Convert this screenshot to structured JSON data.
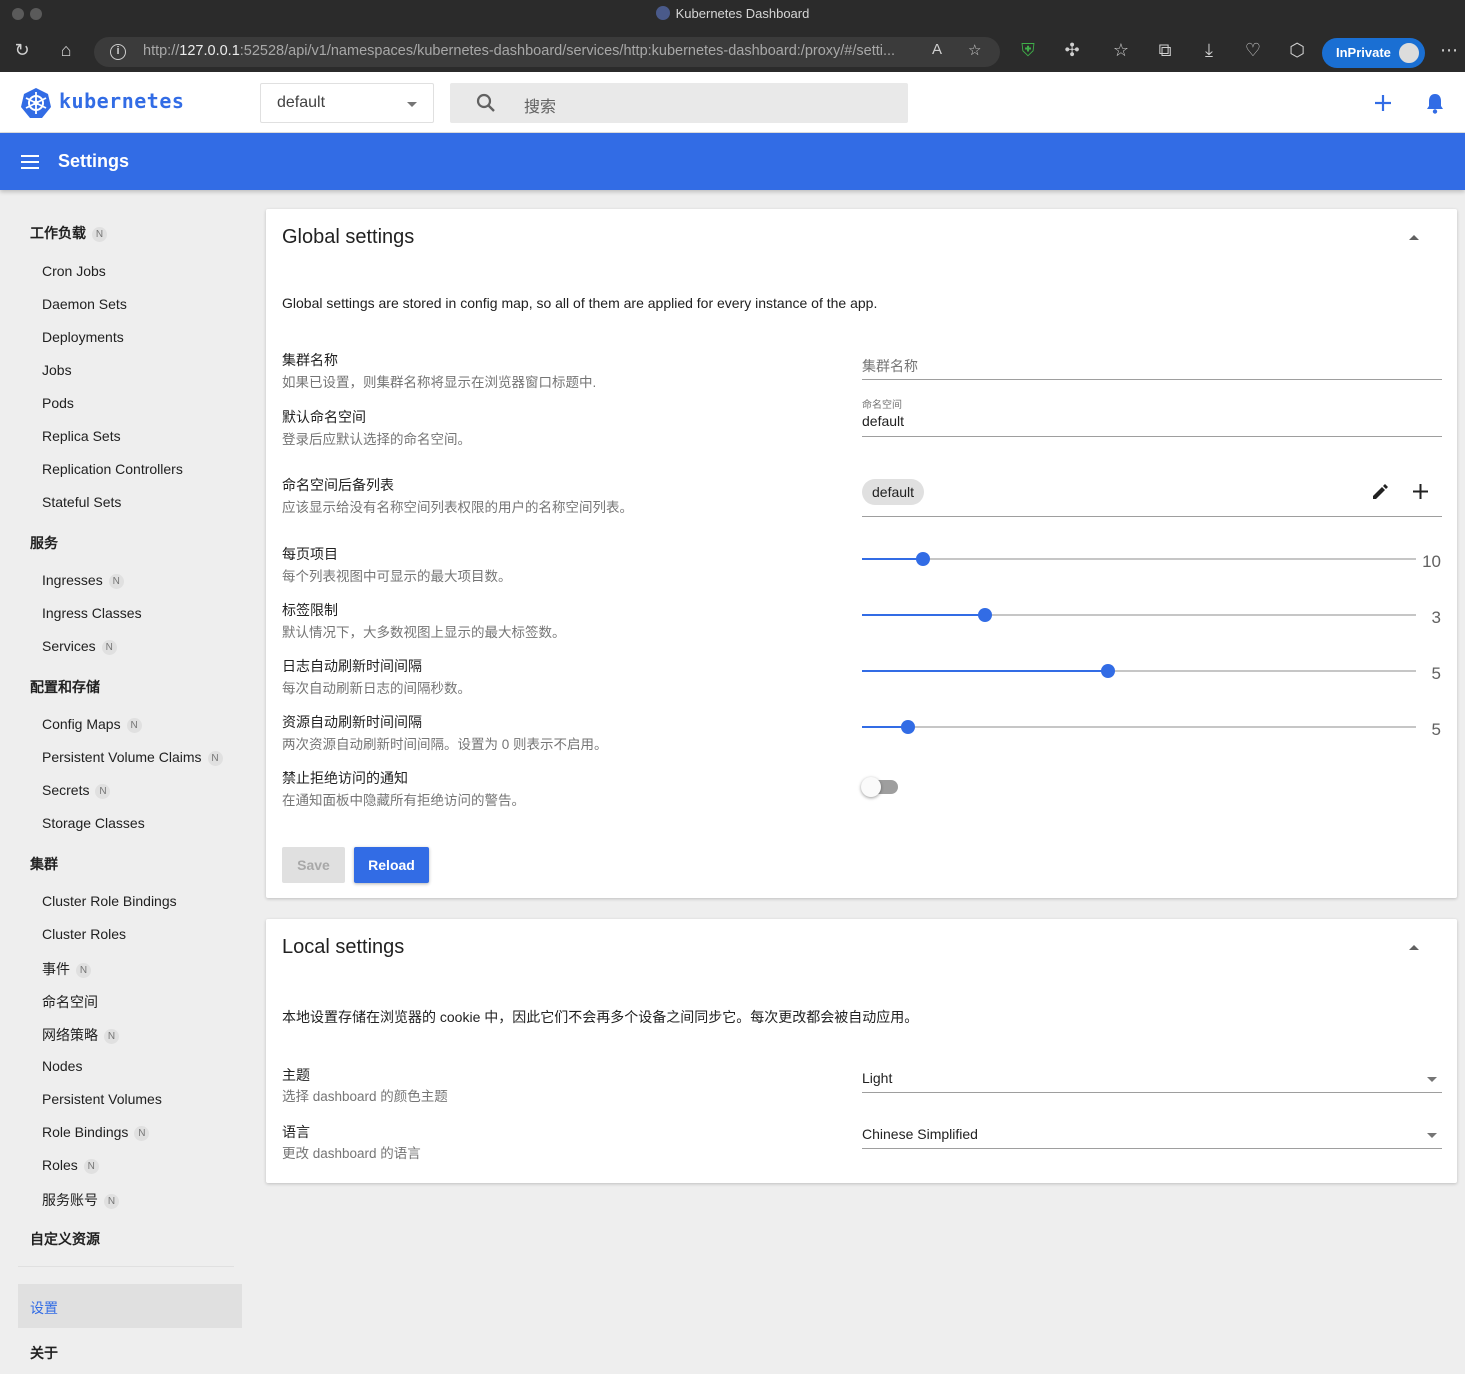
{
  "browser": {
    "window_title": "Kubernetes Dashboard",
    "url_prefix": "http://",
    "url_host": "127.0.0.1",
    "url_rest": ":52528/api/v1/namespaces/kubernetes-dashboard/services/http:kubernetes-dashboard:/proxy/#/setti...",
    "inprivate_label": "InPrivate"
  },
  "header": {
    "brand": "kubernetes",
    "namespace_selected": "default",
    "search_placeholder": "搜索"
  },
  "title_bar": {
    "title": "Settings"
  },
  "sidebar": {
    "badge": "N",
    "sections": [
      {
        "label": "工作负载",
        "badge": true,
        "items": [
          {
            "label": "Cron Jobs"
          },
          {
            "label": "Daemon Sets"
          },
          {
            "label": "Deployments"
          },
          {
            "label": "Jobs"
          },
          {
            "label": "Pods"
          },
          {
            "label": "Replica Sets"
          },
          {
            "label": "Replication Controllers"
          },
          {
            "label": "Stateful Sets"
          }
        ]
      },
      {
        "label": "服务",
        "items": [
          {
            "label": "Ingresses",
            "badge": true
          },
          {
            "label": "Ingress Classes"
          },
          {
            "label": "Services",
            "badge": true
          }
        ]
      },
      {
        "label": "配置和存储",
        "items": [
          {
            "label": "Config Maps",
            "badge": true
          },
          {
            "label": "Persistent Volume Claims",
            "badge": true
          },
          {
            "label": "Secrets",
            "badge": true
          },
          {
            "label": "Storage Classes"
          }
        ]
      },
      {
        "label": "集群",
        "items": [
          {
            "label": "Cluster Role Bindings"
          },
          {
            "label": "Cluster Roles"
          },
          {
            "label": "事件",
            "badge": true
          },
          {
            "label": "命名空间"
          },
          {
            "label": "网络策略",
            "badge": true
          },
          {
            "label": "Nodes"
          },
          {
            "label": "Persistent Volumes"
          },
          {
            "label": "Role Bindings",
            "badge": true
          },
          {
            "label": "Roles",
            "badge": true
          },
          {
            "label": "服务账号",
            "badge": true
          }
        ]
      },
      {
        "label": "自定义资源",
        "items": []
      }
    ],
    "settings_label": "设置",
    "about_label": "关于",
    "colors": {
      "active": "#326ce5"
    }
  },
  "global_settings": {
    "title": "Global settings",
    "description": "Global settings are stored in config map, so all of them are applied for every instance of the app.",
    "cluster_name": {
      "label": "集群名称",
      "help": "如果已设置，则集群名称将显示在浏览器窗口标题中.",
      "placeholder": "集群名称",
      "value": ""
    },
    "default_namespace": {
      "label": "默认命名空间",
      "help": "登录后应默认选择的命名空间。",
      "field_label": "命名空间",
      "value": "default"
    },
    "fallback_namespaces": {
      "label": "命名空间后备列表",
      "help": "应该显示给没有名称空间列表权限的用户的名称空间列表。",
      "chips": [
        "default"
      ]
    },
    "items_per_page": {
      "label": "每页项目",
      "help": "每个列表视图中可显示的最大项目数。",
      "value": "10",
      "fill_fraction": 0.111
    },
    "labels_limit": {
      "label": "标签限制",
      "help": "默认情况下，大多数视图上显示的最大标签数。",
      "value": "3",
      "fill_fraction": 0.222
    },
    "logs_refresh": {
      "label": "日志自动刷新时间间隔",
      "help": "每次自动刷新日志的间隔秒数。",
      "value": "5",
      "fill_fraction": 0.444
    },
    "resource_refresh": {
      "label": "资源自动刷新时间间隔",
      "help": "两次资源自动刷新时间间隔。设置为 0 则表示不启用。",
      "value": "5",
      "fill_fraction": 0.083
    },
    "disable_access_denied": {
      "label": "禁止拒绝访问的通知",
      "help": "在通知面板中隐藏所有拒绝访问的警告。",
      "enabled": false
    },
    "save_label": "Save",
    "reload_label": "Reload"
  },
  "local_settings": {
    "title": "Local settings",
    "description": "本地设置存储在浏览器的 cookie 中，因此它们不会再多个设备之间同步它。每次更改都会被自动应用。",
    "theme": {
      "label": "主题",
      "help": "选择 dashboard 的颜色主题",
      "value": "Light"
    },
    "language": {
      "label": "语言",
      "help": "更改 dashboard 的语言",
      "value": "Chinese Simplified"
    }
  }
}
